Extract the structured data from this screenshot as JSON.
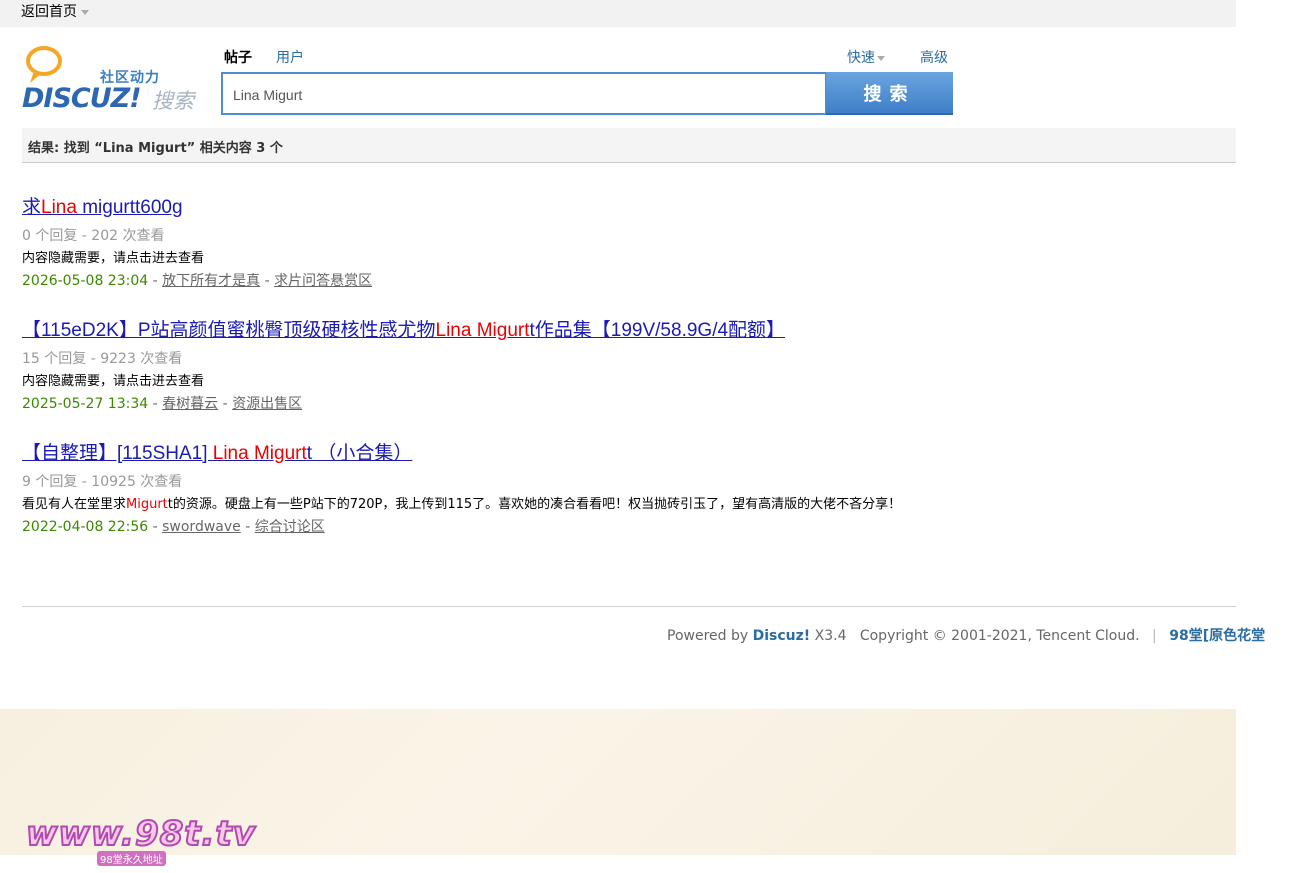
{
  "topbar": {
    "back_home": "返回首页"
  },
  "logo": {
    "cn": "社区动力",
    "brand": "DISCUZ!",
    "sou": "搜索"
  },
  "search": {
    "tab_posts": "帖子",
    "tab_users": "用户",
    "quick": "快速",
    "advanced": "高级",
    "query": "Lina Migurt",
    "button": "搜索"
  },
  "summary": "结果: 找到 “Lina Migurt” 相关内容 3 个",
  "results": [
    {
      "title_pre": "求",
      "title_hl": "Lina",
      "title_post": " migurtt600g",
      "stats": "0 个回复 - 202 次查看",
      "summary_pre": "内容隐藏需要，请点击进去查看",
      "summary_hl": "",
      "summary_post": "",
      "date": "2026-05-08 23:04",
      "author": "放下所有才是真",
      "forum": "求片问答悬赏区"
    },
    {
      "title_pre": "【115eD2K】P站高颜值蜜桃臀顶级硬核性感尤物",
      "title_hl": "Lina Migurt",
      "title_post": "t作品集【199V/58.9G/4配额】",
      "stats": "15 个回复 - 9223 次查看",
      "summary_pre": "内容隐藏需要，请点击进去查看",
      "summary_hl": "",
      "summary_post": "",
      "date": "2025-05-27 13:34",
      "author": "春树暮云",
      "forum": "资源出售区"
    },
    {
      "title_pre": "【自整理】[115SHA1] ",
      "title_hl": "Lina Migurt",
      "title_post": "t （小合集）",
      "stats": "9 个回复 - 10925 次查看",
      "summary_pre": "看见有人在堂里求",
      "summary_hl": "Migurt",
      "summary_post": "t的资源。硬盘上有一些P站下的720P，我上传到115了。喜欢她的凑合看看吧！权当抛砖引玉了，望有高清版的大佬不吝分享！",
      "date": "2022-04-08 22:56",
      "author": "swordwave",
      "forum": "综合讨论区"
    }
  ],
  "footer": {
    "powered": "Powered by",
    "brand": "Discuz!",
    "version": "X3.4",
    "copyright": "Copyright © 2001-2021, Tencent Cloud.",
    "sep": "|",
    "site": "98堂[原色花堂"
  },
  "watermark": {
    "main": "www.98t.tv",
    "sub": "98堂永久地址"
  },
  "sep_dash": " - "
}
